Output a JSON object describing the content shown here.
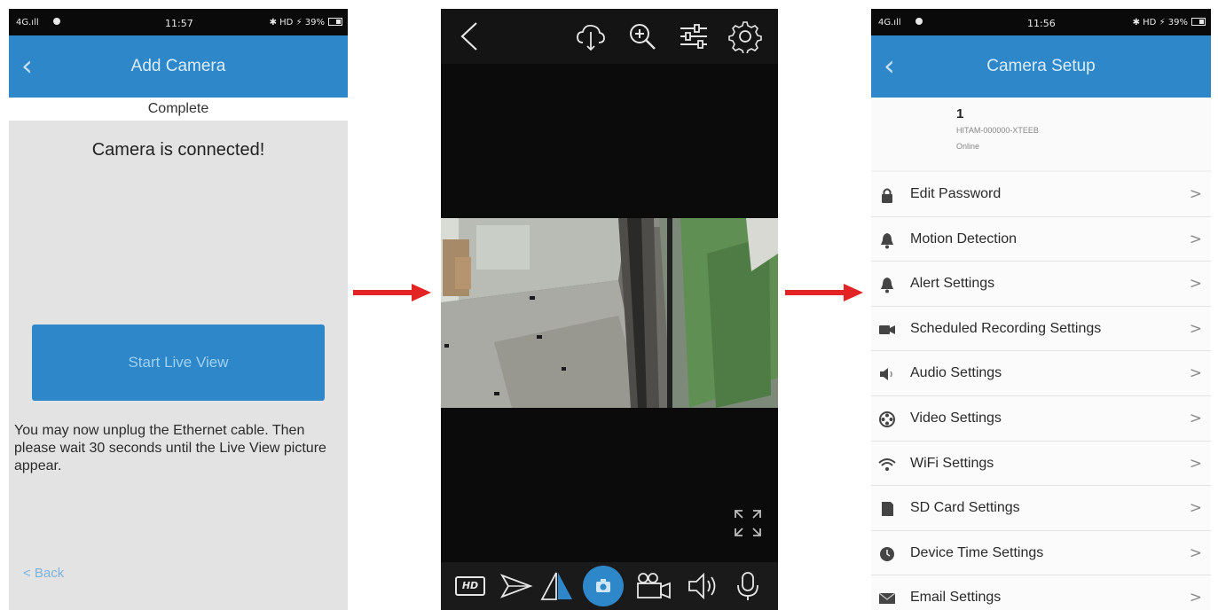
{
  "panels": {
    "add_camera": {
      "status_bar": {
        "network": "4G.ıll",
        "time": "11:57",
        "indicators": "✱ HD ⚡ 39%"
      },
      "title": "Add Camera",
      "back_chevron": "‹",
      "subheading": "Complete",
      "message": "Camera is connected!",
      "start_button": "Start Live View",
      "note": "You may now unplug the Ethernet cable. Then please wait 30 seconds until the Live View picture appear.",
      "back_link": "< Back"
    },
    "live_view": {
      "top_icons": [
        "back-icon",
        "ptz-cloud-icon",
        "zoom-in-icon",
        "adjust-sliders-icon",
        "settings-gear-icon"
      ],
      "hd_label": "HD",
      "bottom_icons": [
        "hd-quality-icon",
        "send-arrow-icon",
        "flip-triangle-icon",
        "snapshot-camera-icon",
        "record-video-icon",
        "speaker-icon",
        "microphone-icon"
      ],
      "accent": "#2e87c9"
    },
    "camera_setup": {
      "status_bar": {
        "network": "4G.ıll",
        "time": "11:56",
        "indicators": "✱ HD ⚡ 39%"
      },
      "title": "Camera Setup",
      "back_chevron": "‹",
      "device": {
        "name": "1",
        "id": "HITAM-000000-XTEEB",
        "status": "Online"
      },
      "menu": [
        {
          "label": "Edit Password",
          "icon": "lock-icon"
        },
        {
          "label": "Motion Detection",
          "icon": "bell-icon"
        },
        {
          "label": "Alert Settings",
          "icon": "bell-icon"
        },
        {
          "label": "Scheduled Recording Settings",
          "icon": "video-camera-icon"
        },
        {
          "label": "Audio Settings",
          "icon": "speaker-icon"
        },
        {
          "label": "Video Settings",
          "icon": "film-reel-icon"
        },
        {
          "label": "WiFi Settings",
          "icon": "wifi-icon"
        },
        {
          "label": "SD Card Settings",
          "icon": "sd-card-icon"
        },
        {
          "label": "Device Time Settings",
          "icon": "clock-icon"
        },
        {
          "label": "Email Settings",
          "icon": "envelope-icon"
        }
      ],
      "chevron": ">"
    }
  },
  "colors": {
    "brand_blue": "#2e87c9",
    "arrow_red": "#e32424"
  }
}
